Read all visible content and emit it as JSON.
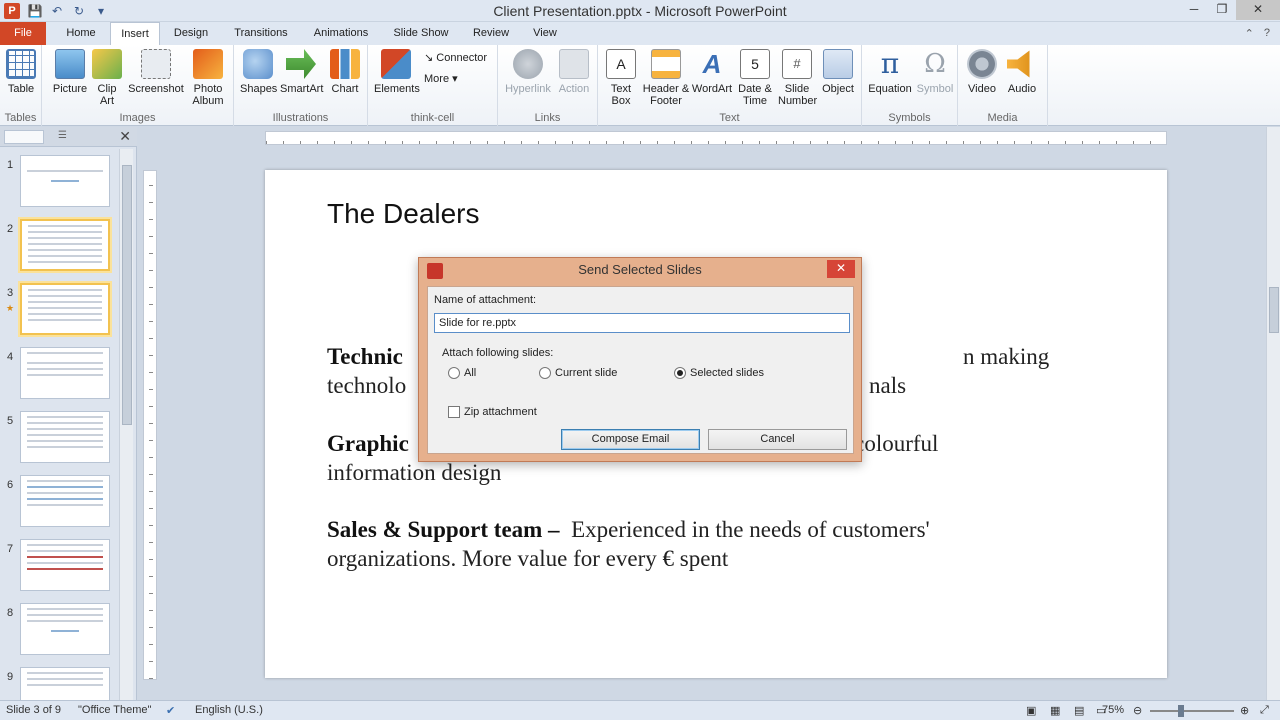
{
  "window": {
    "title": "Client Presentation.pptx - Microsoft PowerPoint",
    "app_icon": "P"
  },
  "tabs": [
    "File",
    "Home",
    "Insert",
    "Design",
    "Transitions",
    "Animations",
    "Slide Show",
    "Review",
    "View"
  ],
  "active_tab": "Insert",
  "ribbon": {
    "groups": {
      "tables": "Tables",
      "images": "Images",
      "illustrations": "Illustrations",
      "thinkcell": "think-cell",
      "links": "Links",
      "text": "Text",
      "symbols": "Symbols",
      "media": "Media"
    },
    "buttons": {
      "table": "Table",
      "picture": "Picture",
      "clipart": "Clip Art",
      "screenshot": "Screenshot",
      "photoalbum": "Photo Album",
      "shapes": "Shapes",
      "smartart": "SmartArt",
      "chart": "Chart",
      "elements": "Elements",
      "connector": "Connector",
      "more": "More",
      "hyperlink": "Hyperlink",
      "action": "Action",
      "textbox": "Text Box",
      "headerfooter": "Header & Footer",
      "wordart": "WordArt",
      "datetime": "Date & Time",
      "slidenumber": "Slide Number",
      "object": "Object",
      "equation": "Equation",
      "symbol": "Symbol",
      "video": "Video",
      "audio": "Audio"
    }
  },
  "slide_pane": {
    "numbers": [
      "1",
      "2",
      "3",
      "4",
      "5",
      "6",
      "7",
      "8",
      "9"
    ],
    "selected": [
      2,
      3
    ]
  },
  "slide": {
    "title": "The Dealers",
    "para1_bold": "Technic",
    "para1_right": "n making",
    "para1_line2_left": "technolo",
    "para1_line2_right": "nals",
    "para2_bold": "Graphic",
    "para2_right": "l colourful",
    "para2_line2": "information design",
    "para3_bold": "Sales & Support team –",
    "para3_text": "Experienced in the needs of customers'",
    "para3_line2": "organizations. More value for every € spent"
  },
  "dialog": {
    "title": "Send Selected Slides",
    "name_label": "Name of attachment:",
    "name_value": "Slide for re.pptx",
    "attach_label": "Attach following slides:",
    "radio_all": "All",
    "radio_current": "Current slide",
    "radio_selected": "Selected slides",
    "selected_option": "Selected slides",
    "zip_label": "Zip attachment",
    "compose": "Compose Email",
    "cancel": "Cancel"
  },
  "statusbar": {
    "slide": "Slide 3 of 9",
    "theme": "\"Office Theme\"",
    "language": "English (U.S.)",
    "zoom": "75%"
  }
}
